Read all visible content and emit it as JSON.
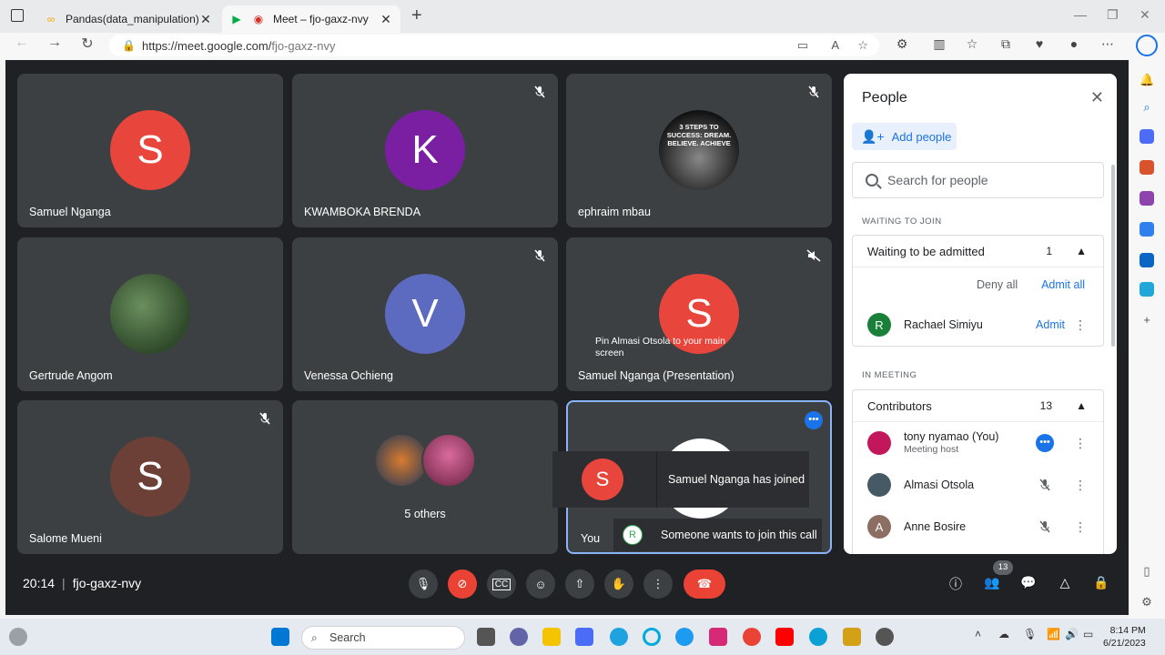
{
  "browser": {
    "tabs": [
      {
        "title": "Pandas(data_manipulation)ipynb",
        "active": false
      },
      {
        "title": "Meet – fjo-gaxz-nvy",
        "active": true
      }
    ],
    "url_host": "https://meet.google.com/",
    "url_path": "fjo-gaxz-nvy"
  },
  "tiles": [
    {
      "name": "Samuel Nganga",
      "initial": "S",
      "color": "#e8453c",
      "muted": false
    },
    {
      "name": "KWAMBOKA BRENDA",
      "initial": "K",
      "color": "#7b1fa2",
      "muted": true
    },
    {
      "name": "ephraim mbau",
      "initial": "",
      "photo_text": "3 STEPS TO SUCCESS: DREAM. BELIEVE. ACHIEVE",
      "muted": true
    },
    {
      "name": "Gertrude Angom",
      "initial": "",
      "muted": false
    },
    {
      "name": "Venessa Ochieng",
      "initial": "V",
      "color": "#5c6bc0",
      "muted": true
    },
    {
      "name": "Samuel Nganga (Presentation)",
      "initial": "S",
      "color": "#e8453c",
      "muted": true,
      "tooltip": "Pin Almasi Otsola to your main screen"
    },
    {
      "name": "Salome Mueni",
      "initial": "S",
      "color": "#6d4037",
      "muted": true
    },
    {
      "name": "",
      "initial": "",
      "others_label": "5 others"
    },
    {
      "name": "You",
      "initial": "",
      "self": true
    }
  ],
  "notifications": {
    "joined": {
      "initial": "S",
      "text": "Samuel Nganga has joined"
    },
    "wants_to_join": {
      "initial": "R",
      "text": "Someone wants to join this call"
    }
  },
  "people_panel": {
    "title": "People",
    "add_people": "Add people",
    "search_placeholder": "Search for people",
    "waiting_section": "WAITING TO JOIN",
    "waiting_group": {
      "label": "Waiting to be admitted",
      "count": "1"
    },
    "deny_all": "Deny all",
    "admit_all": "Admit all",
    "waiting_people": [
      {
        "initial": "R",
        "name": "Rachael Simiyu",
        "action": "Admit",
        "color": "#188038"
      }
    ],
    "meeting_section": "IN MEETING",
    "contributors_group": {
      "label": "Contributors",
      "count": "13"
    },
    "contributors": [
      {
        "name": "tony nyamao (You)",
        "sub": "Meeting host",
        "color": "#c2185b"
      },
      {
        "name": "Almasi Otsola",
        "sub": "",
        "color": "#455a64"
      },
      {
        "initial": "A",
        "name": "Anne Bosire",
        "sub": "",
        "color": "#8d6e63"
      }
    ]
  },
  "controls": {
    "time": "20:14",
    "meeting_code": "fjo-gaxz-nvy",
    "participants_badge": "13"
  },
  "taskbar": {
    "search_label": "Search",
    "time": "8:14 PM",
    "date": "6/21/2023"
  }
}
